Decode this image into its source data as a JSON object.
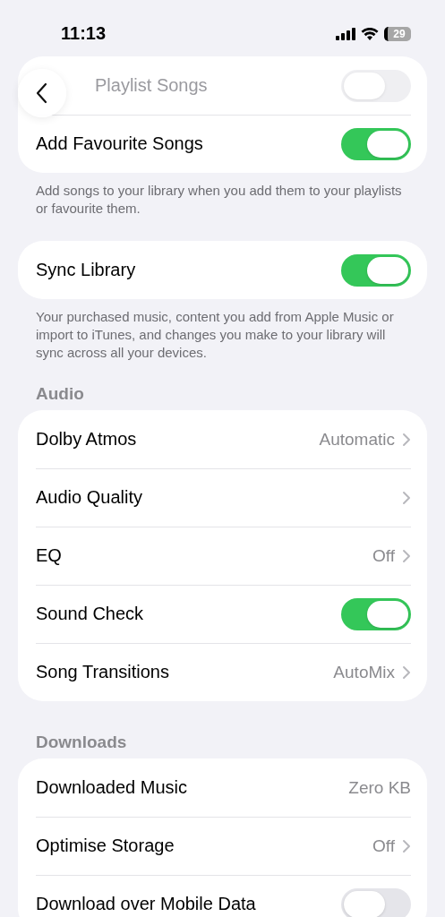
{
  "status_bar": {
    "time": "11:13",
    "battery": "29"
  },
  "sections": [
    {
      "rows": [
        {
          "kind": "toggle",
          "label": "Playlist Songs",
          "on": false,
          "dimmed": true
        },
        {
          "kind": "toggle",
          "label": "Add Favourite Songs",
          "on": true,
          "dimmed": false
        }
      ],
      "footer": "Add songs to your library when you add them to your playlists or favourite them."
    },
    {
      "rows": [
        {
          "kind": "toggle",
          "label": "Sync Library",
          "on": true,
          "dimmed": false
        }
      ],
      "footer": "Your purchased music, content you add from Apple Music or import to iTunes, and changes you make to your library will sync across all your devices."
    },
    {
      "header": "Audio",
      "rows": [
        {
          "kind": "link",
          "label": "Dolby Atmos",
          "value": "Automatic",
          "dimmed": false
        },
        {
          "kind": "link",
          "label": "Audio Quality",
          "dimmed": false
        },
        {
          "kind": "link",
          "label": "EQ",
          "value": "Off",
          "dimmed": false
        },
        {
          "kind": "toggle",
          "label": "Sound Check",
          "on": true,
          "dimmed": false
        },
        {
          "kind": "link",
          "label": "Song Transitions",
          "value": "AutoMix",
          "dimmed": false
        }
      ]
    },
    {
      "header": "Downloads",
      "rows": [
        {
          "kind": "value",
          "label": "Downloaded Music",
          "value": "Zero KB",
          "dimmed": false
        },
        {
          "kind": "link",
          "label": "Optimise Storage",
          "value": "Off",
          "dimmed": false
        },
        {
          "kind": "toggle",
          "label": "Download over Mobile Data",
          "on": false,
          "dimmed": false
        }
      ]
    }
  ]
}
